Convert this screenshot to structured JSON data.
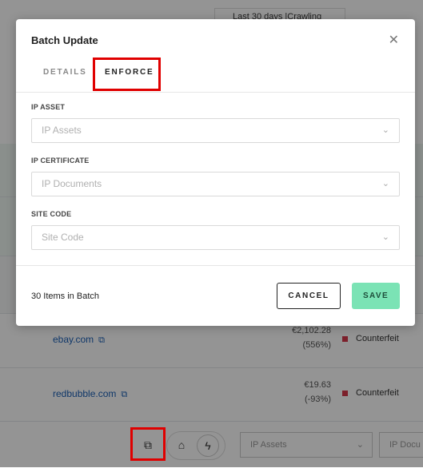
{
  "background": {
    "date_filter": "Last 30 days  |Crawling",
    "rows": [
      {
        "site": "ebay.com",
        "price": "€2,102.28",
        "change": "(556%)",
        "status": "Counterfeit"
      },
      {
        "site": "redbubble.com",
        "price": "€19.63",
        "change": "(-93%)",
        "status": "Counterfeit"
      }
    ],
    "bottombar": {
      "ip_assets_placeholder": "IP Assets",
      "ip_documents_placeholder": "IP Docu"
    }
  },
  "modal": {
    "title": "Batch Update",
    "tabs": [
      "DETAILS",
      "ENFORCE"
    ],
    "active_tab": "ENFORCE",
    "fields": [
      {
        "label": "IP ASSET",
        "placeholder": "IP Assets"
      },
      {
        "label": "IP CERTIFICATE",
        "placeholder": "IP Documents"
      },
      {
        "label": "SITE CODE",
        "placeholder": "Site Code"
      }
    ],
    "batch_count_text": "30 Items in Batch",
    "cancel_label": "CANCEL",
    "save_label": "SAVE"
  },
  "colors": {
    "accent": "#7be3b5",
    "highlight": "#e00000",
    "status_counterfeit": "#d6384a"
  }
}
